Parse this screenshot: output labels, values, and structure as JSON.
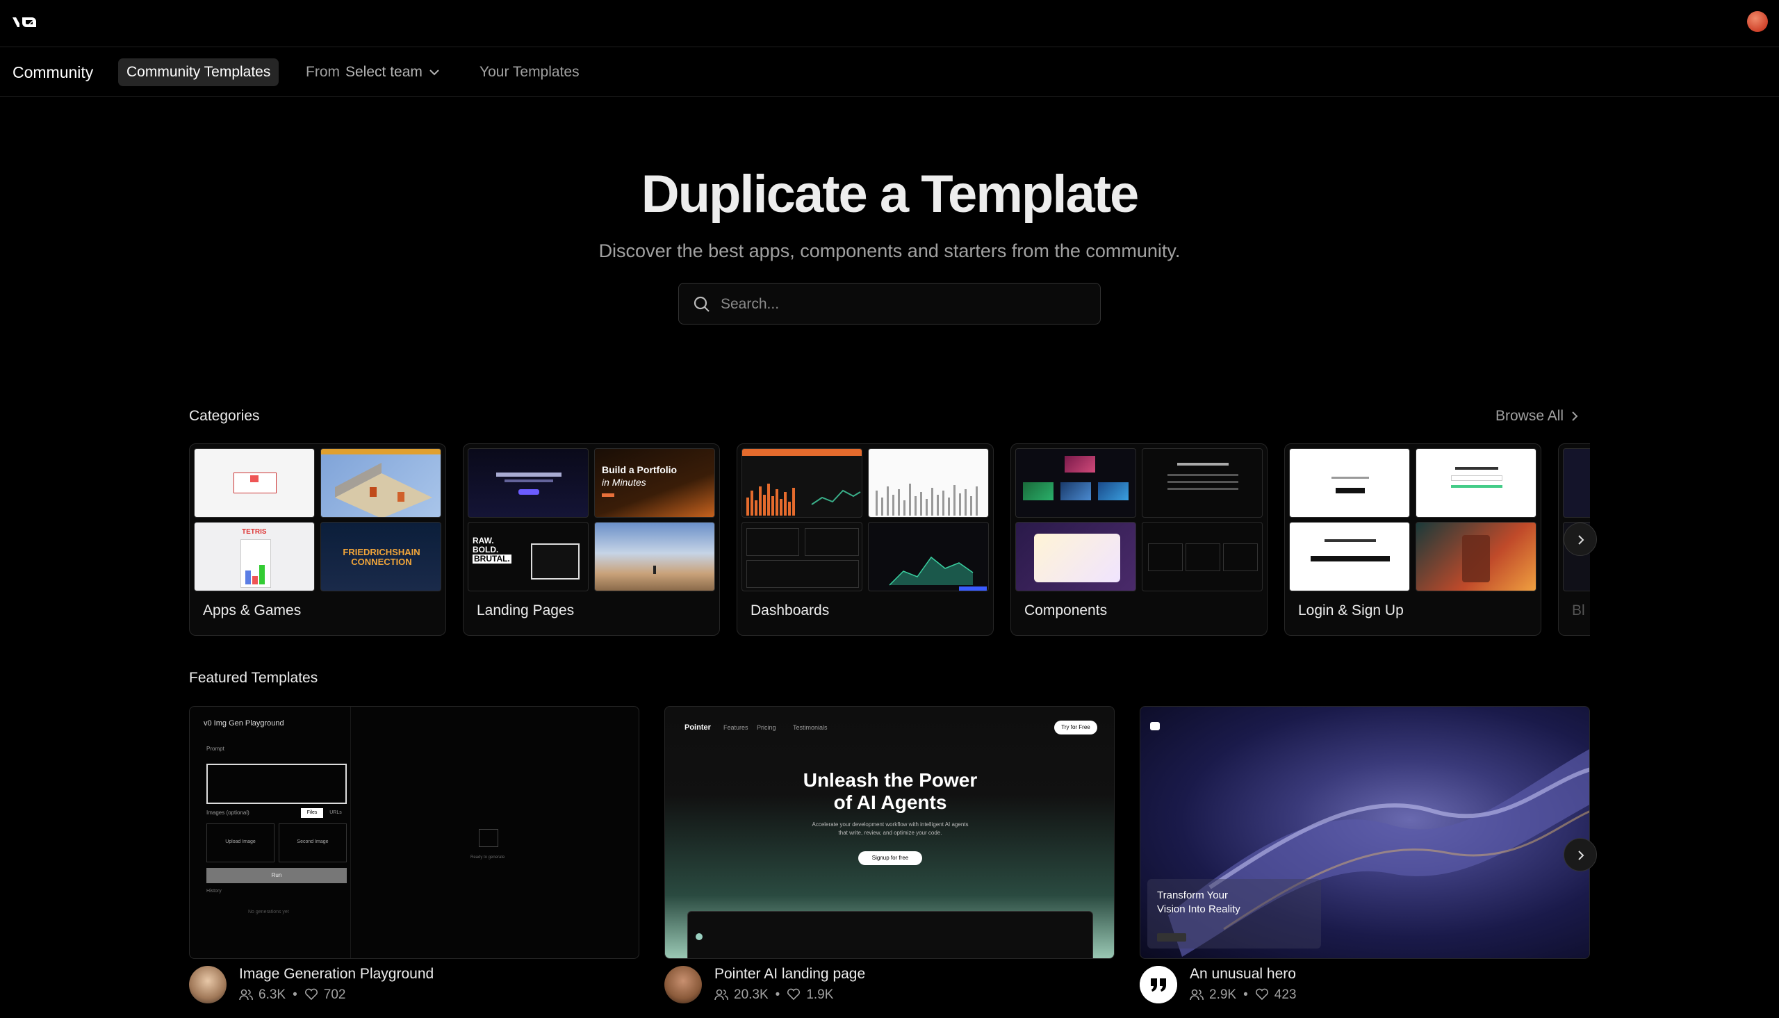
{
  "app": {
    "logo": "v0"
  },
  "subnav": {
    "brand": "Community",
    "tabs": {
      "community_templates": "Community Templates",
      "from_label": "From",
      "from_value": "Select team",
      "your_templates": "Your Templates"
    }
  },
  "hero": {
    "title": "Duplicate a Template",
    "subtitle": "Discover the best apps, components and starters from the community.",
    "search_placeholder": "Search..."
  },
  "categories": {
    "title": "Categories",
    "browse_all": "Browse All",
    "items": [
      {
        "label": "Apps & Games"
      },
      {
        "label": "Landing Pages"
      },
      {
        "label": "Dashboards"
      },
      {
        "label": "Components"
      },
      {
        "label": "Login & Sign Up"
      },
      {
        "label": "Bl"
      }
    ],
    "thumb_text": {
      "tetris": "TETRIS",
      "friedrichshain": "FRIEDRICHSHAIN CONNECTION",
      "portfolio_1": "Build a Portfolio",
      "portfolio_2": "in Minutes",
      "raw_1": "RAW.",
      "raw_2": "BOLD.",
      "raw_3": "BRUTAL."
    }
  },
  "featured": {
    "title": "Featured Templates",
    "items": [
      {
        "name": "Image Generation Playground",
        "users": "6.3K",
        "likes": "702"
      },
      {
        "name": "Pointer AI landing page",
        "users": "20.3K",
        "likes": "1.9K"
      },
      {
        "name": "An unusual hero",
        "users": "2.9K",
        "likes": "423"
      }
    ],
    "previews": {
      "img_gen": {
        "title": "v0 Img Gen Playground",
        "prompt": "Prompt",
        "images_optional": "Images (optional)",
        "files": "Files",
        "urls": "URLs",
        "upload": "Upload Image",
        "second": "Second Image",
        "run": "Run",
        "history": "History",
        "no_gens": "No generations yet",
        "ready": "Ready to generate"
      },
      "pointer": {
        "brand": "Pointer",
        "nav_features": "Features",
        "nav_pricing": "Pricing",
        "nav_testimonials": "Testimonials",
        "cta": "Try for Free",
        "headline_1": "Unleash the Power",
        "headline_2": "of AI Agents",
        "body": "Accelerate your development workflow with intelligent AI agents that write, review, and optimize your code.",
        "signup": "Signup for free"
      },
      "hero": {
        "line1": "Transform Your",
        "line2": "Vision Into Reality"
      }
    }
  }
}
